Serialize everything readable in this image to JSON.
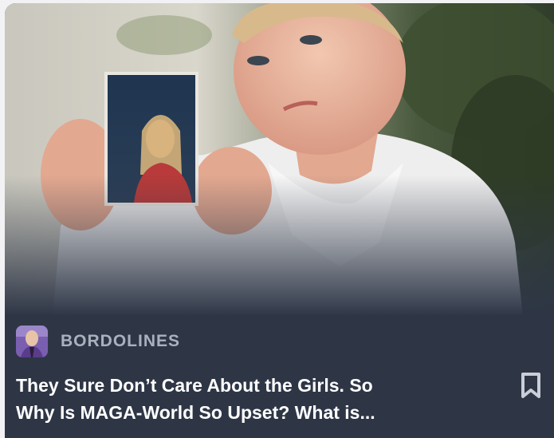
{
  "article": {
    "publication": "BORDOLINES",
    "title": "They Sure Don’t Care About the Girls. So\nWhy Is MAGA-World So Upset? What is..."
  },
  "icons": {
    "publication_avatar": "publication-avatar",
    "bookmark": "bookmark-icon"
  },
  "colors": {
    "card_background": "#2e3646",
    "publication_text": "#aab1be",
    "title_text": "#ffffff"
  }
}
